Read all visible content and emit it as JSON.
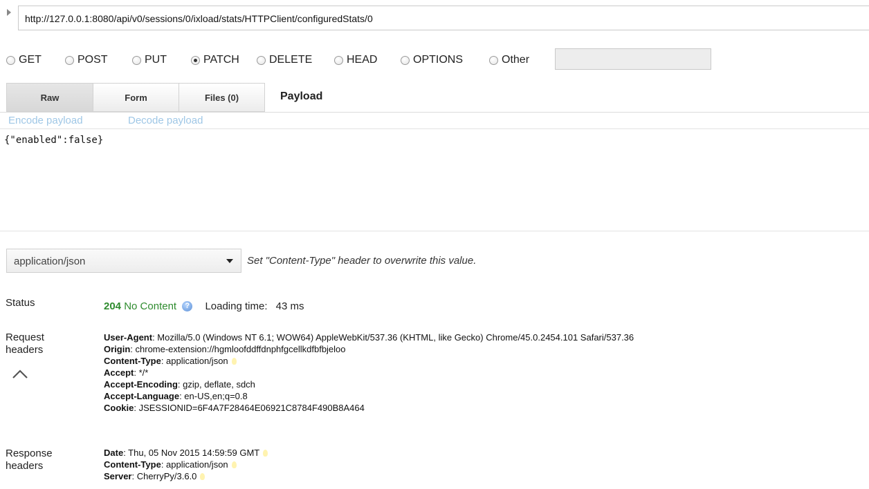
{
  "request": {
    "url": "http://127.0.0.1:8080/api/v0/sessions/0/ixload/stats/HTTPClient/configuredStats/0",
    "methods": [
      {
        "label": "GET",
        "checked": false
      },
      {
        "label": "POST",
        "checked": false
      },
      {
        "label": "PUT",
        "checked": false
      },
      {
        "label": "PATCH",
        "checked": true
      },
      {
        "label": "DELETE",
        "checked": false
      },
      {
        "label": "HEAD",
        "checked": false
      },
      {
        "label": "OPTIONS",
        "checked": false
      },
      {
        "label": "Other",
        "checked": false
      }
    ],
    "other_value": ""
  },
  "tabs": {
    "raw": "Raw",
    "form": "Form",
    "files": "Files (0)",
    "active": "Raw"
  },
  "payload": {
    "title": "Payload",
    "encode_link": "Encode payload",
    "decode_link": "Decode payload",
    "body": "{\"enabled\":false}"
  },
  "content_type": {
    "value": "application/json",
    "hint": "Set \"Content-Type\" header to overwrite this value."
  },
  "response": {
    "status_label": "Status",
    "status_code": "204",
    "status_text": "No Content",
    "help_icon": "help-icon",
    "loading_label": "Loading time:",
    "loading_value": "43 ms",
    "request_headers_label": "Request headers",
    "response_headers_label": "Response headers",
    "request_headers": [
      {
        "name": "User-Agent",
        "value": ": Mozilla/5.0 (Windows NT 6.1; WOW64) AppleWebKit/537.36 (KHTML, like Gecko) Chrome/45.0.2454.101 Safari/537.36",
        "hint": false
      },
      {
        "name": "Origin",
        "value": ": chrome-extension://hgmloofddffdnphfgcellkdfbfbjeloo",
        "hint": false
      },
      {
        "name": "Content-Type",
        "value": ": application/json",
        "hint": true
      },
      {
        "name": "Accept",
        "value": ": */*",
        "hint": false
      },
      {
        "name": "Accept-Encoding",
        "value": ": gzip, deflate, sdch",
        "hint": false
      },
      {
        "name": "Accept-Language",
        "value": ": en-US,en;q=0.8",
        "hint": false
      },
      {
        "name": "Cookie",
        "value": ": JSESSIONID=6F4A7F28464E06921C8784F490B8A464",
        "hint": false
      }
    ],
    "response_headers": [
      {
        "name": "Date",
        "value": ": Thu, 05 Nov 2015 14:59:59 GMT",
        "hint": true
      },
      {
        "name": "Content-Type",
        "value": ": application/json",
        "hint": true
      },
      {
        "name": "Server",
        "value": ": CherryPy/3.6.0",
        "hint": true
      }
    ]
  },
  "colors": {
    "status_ok": "#2e8b2e",
    "link": "#9fc7e6",
    "hint_bulb": "#fff3b0"
  }
}
